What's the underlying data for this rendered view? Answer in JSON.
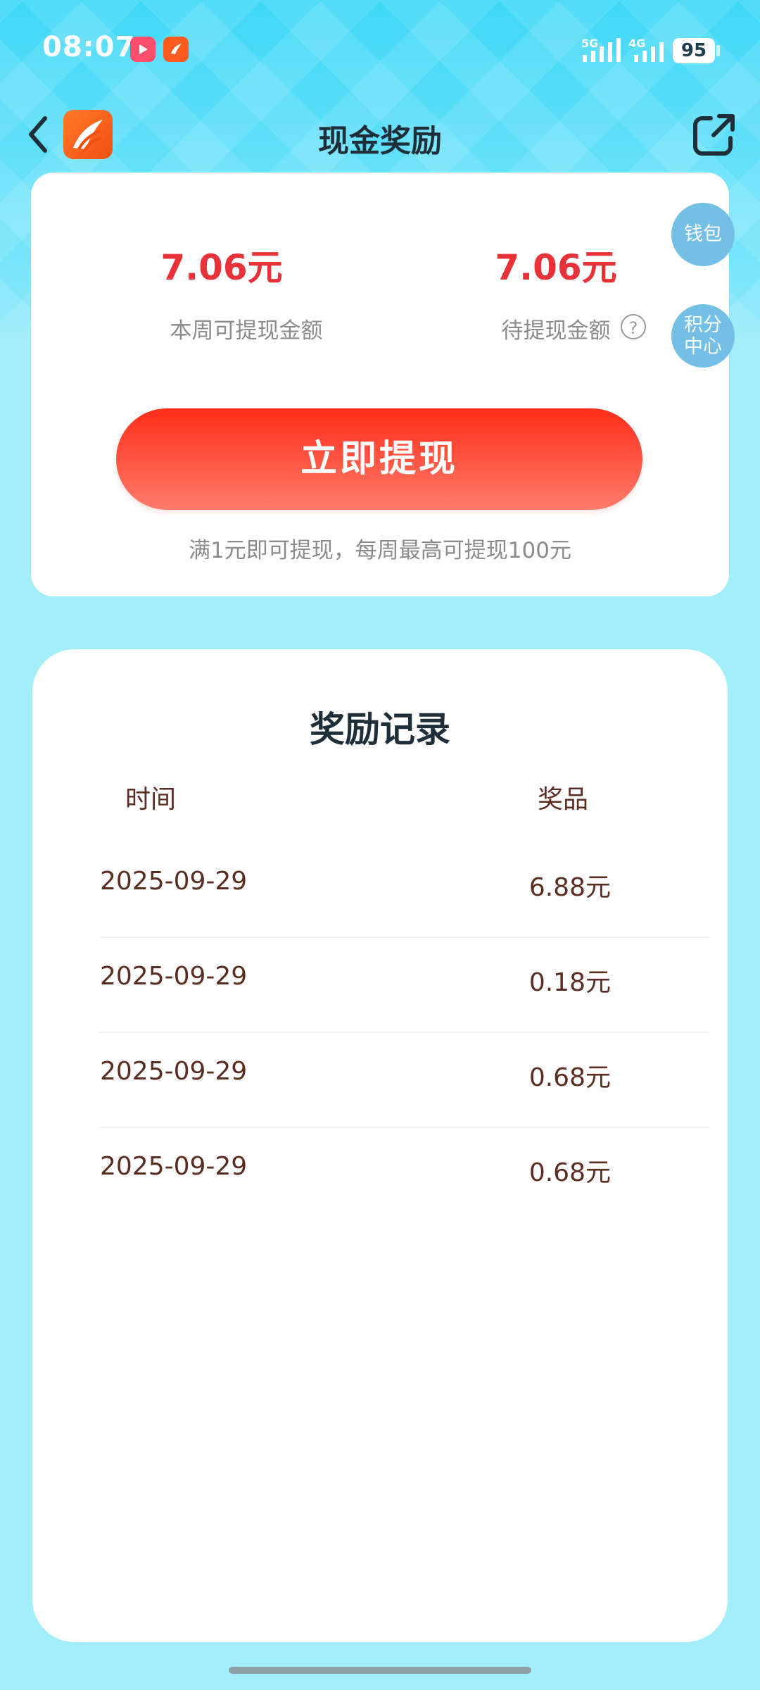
{
  "status_bar": {
    "time": "08:07",
    "signal1_label": "5G",
    "signal2_label": "4G",
    "battery": "95"
  },
  "header": {
    "title": "现金奖励"
  },
  "summary": {
    "weekly_amount": "7.06元",
    "weekly_label": "本周可提现金额",
    "pending_amount": "7.06元",
    "pending_label": "待提现金额",
    "help_symbol": "?",
    "withdraw_button": "立即提现",
    "note": "满1元即可提现，每周最高可提现100元"
  },
  "side_buttons": {
    "wallet": "钱包",
    "points_line1": "积分",
    "points_line2": "中心"
  },
  "records": {
    "title": "奖励记录",
    "col_time": "时间",
    "col_prize": "奖品",
    "rows": [
      {
        "date": "2025-09-29",
        "value": "6.88元"
      },
      {
        "date": "2025-09-29",
        "value": "0.18元"
      },
      {
        "date": "2025-09-29",
        "value": "0.68元"
      },
      {
        "date": "2025-09-29",
        "value": "0.68元"
      }
    ]
  },
  "colors": {
    "accent_red": "#e8323a",
    "button_gradient_top": "#ff2e1a",
    "side_button": "#73bfe6",
    "record_text": "#5a2d22"
  }
}
